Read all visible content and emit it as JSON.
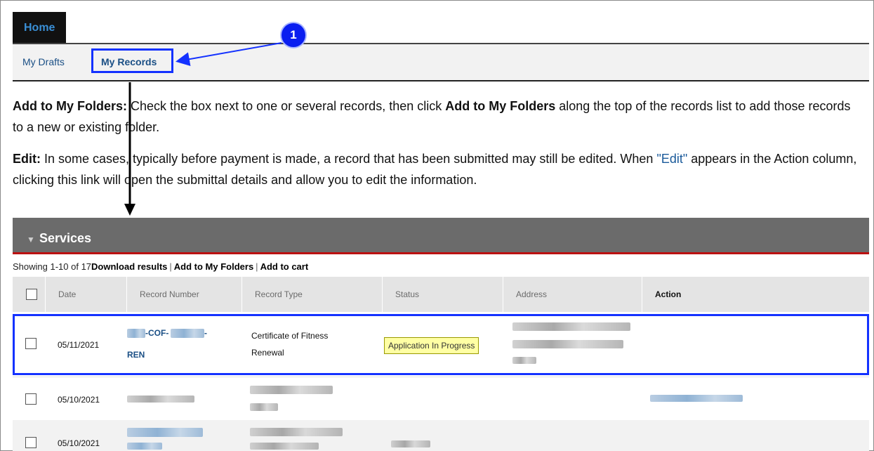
{
  "nav": {
    "home_tab": "Home",
    "tabs": [
      {
        "label": "My Drafts"
      },
      {
        "label": "My Records"
      }
    ],
    "callout_number": "1"
  },
  "instructions": {
    "add_folders": {
      "bold": "Add to My Folders:",
      "text_a": " Check the box next to one or several records, then click ",
      "bold2": "Add to My Folders",
      "text_b": " along the top of the records list to add those records to a new or existing folder."
    },
    "edit": {
      "bold": "Edit:",
      "text_a": " In some cases, typically before payment is made, a record that has been submitted may still be edited. When ",
      "link": "\"Edit\"",
      "text_b": " appears in the Action column, clicking this link will open the submittal details and allow you to edit the information."
    }
  },
  "services": {
    "title": "Services",
    "showing": "Showing 1-10 of 17",
    "actions": [
      "Download results",
      "Add to My Folders",
      "Add to cart"
    ]
  },
  "table": {
    "headers": [
      "Date",
      "Record Number",
      "Record Type",
      "Status",
      "Address",
      "Action"
    ],
    "rows": [
      {
        "date": "05/11/2021",
        "record_prefix": "-COF-",
        "record_suffix": "-",
        "record_line2": "REN",
        "type_line1": "Certificate of Fitness",
        "type_line2": "Renewal",
        "status": "Application In Progress"
      },
      {
        "date": "05/10/2021"
      },
      {
        "date": "05/10/2021"
      }
    ]
  },
  "colors": {
    "highlight": "#1432ff",
    "link": "#1a4f85",
    "services_bar": "#6b6b6b",
    "status_badge": "#ffffa4"
  }
}
